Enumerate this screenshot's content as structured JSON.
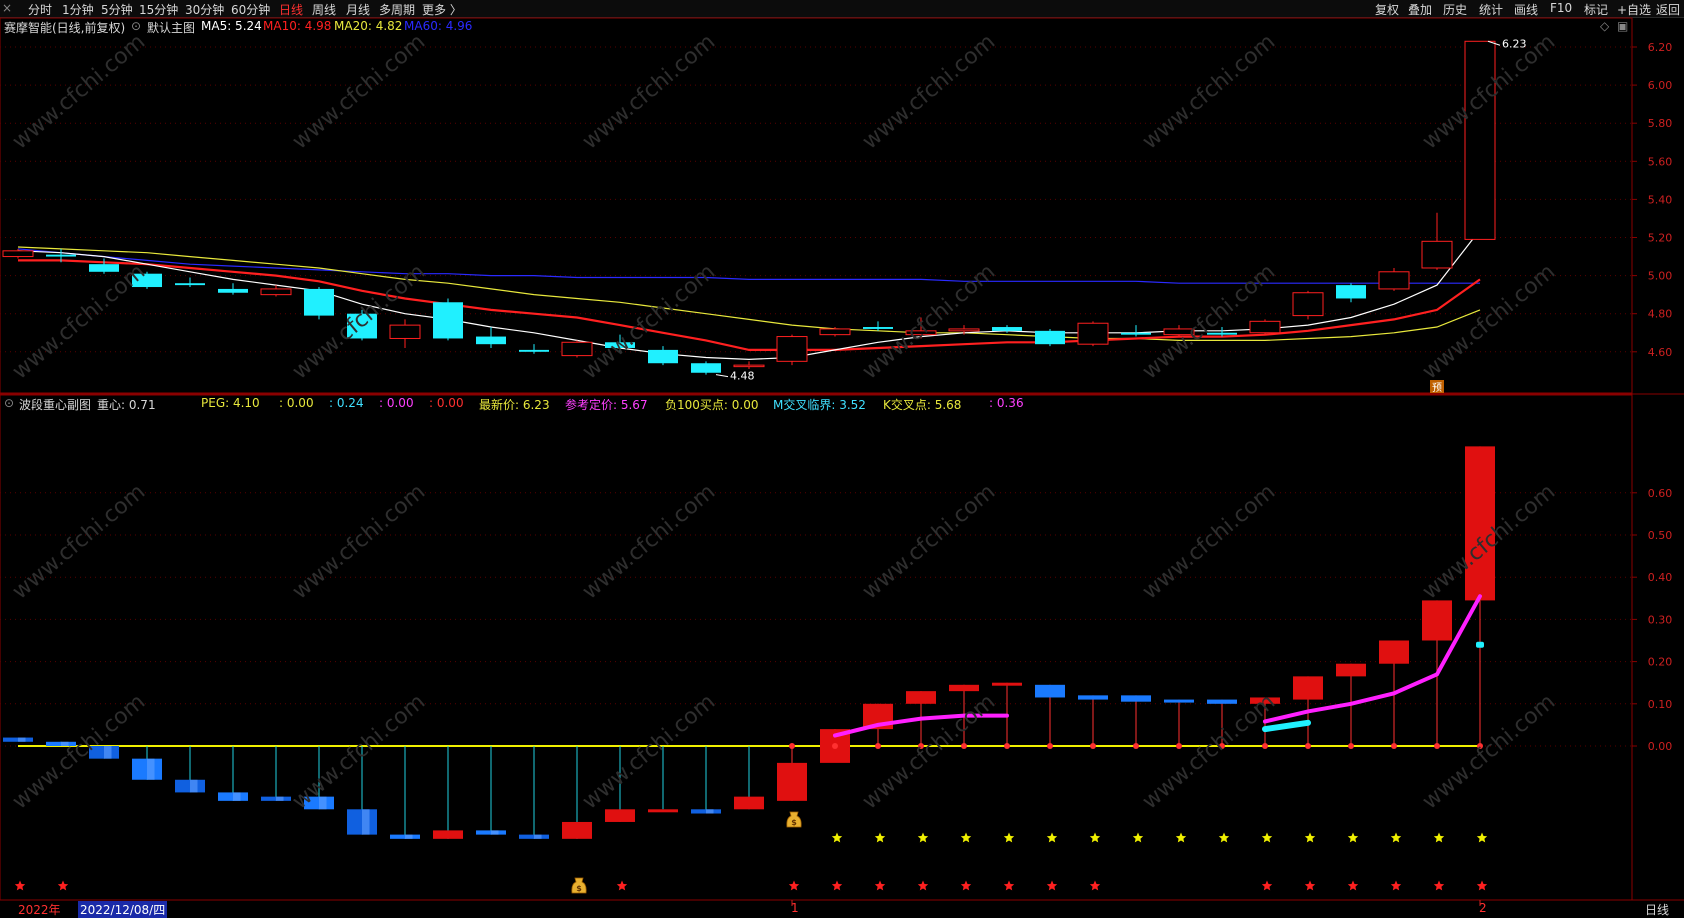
{
  "toolbar": {
    "menu_icon": "×",
    "periods": [
      {
        "label": "分时",
        "active": false
      },
      {
        "label": "1分钟",
        "active": false
      },
      {
        "label": "5分钟",
        "active": false
      },
      {
        "label": "15分钟",
        "active": false
      },
      {
        "label": "30分钟",
        "active": false
      },
      {
        "label": "60分钟",
        "active": false
      },
      {
        "label": "日线",
        "active": true
      },
      {
        "label": "周线",
        "active": false
      },
      {
        "label": "月线",
        "active": false
      },
      {
        "label": "多周期",
        "active": false
      },
      {
        "label": "更多 〉",
        "active": false
      }
    ],
    "right_items": [
      "复权",
      "叠加",
      "历史",
      "统计",
      "画线",
      "F10",
      "标记",
      "+自选",
      "返回"
    ]
  },
  "main_chart": {
    "title": "赛摩智能(日线,前复权)",
    "indicator_name": "默认主图",
    "ma": [
      {
        "label": "MA5: 5.24",
        "color": "#ffffff"
      },
      {
        "label": "MA10: 4.98",
        "color": "#ff2020"
      },
      {
        "label": "MA20: 4.82",
        "color": "#e8e83c"
      },
      {
        "label": "MA60: 4.96",
        "color": "#2a2aff"
      }
    ],
    "y_ticks": [
      "6.20",
      "6.00",
      "5.80",
      "5.60",
      "5.40",
      "5.20",
      "5.00",
      "4.80",
      "4.60"
    ],
    "high_label": "6.23",
    "low_label": "4.48",
    "pre_marker": "预",
    "candles": [
      {
        "o": 5.1,
        "c": 5.13,
        "h": 5.14,
        "l": 5.09
      },
      {
        "o": 5.11,
        "c": 5.1,
        "h": 5.14,
        "l": 5.07
      },
      {
        "o": 5.06,
        "c": 5.02,
        "h": 5.09,
        "l": 5.01
      },
      {
        "o": 5.01,
        "c": 4.94,
        "h": 5.02,
        "l": 4.93
      },
      {
        "o": 4.96,
        "c": 4.95,
        "h": 4.99,
        "l": 4.94
      },
      {
        "o": 4.93,
        "c": 4.91,
        "h": 4.96,
        "l": 4.9
      },
      {
        "o": 4.9,
        "c": 4.93,
        "h": 4.95,
        "l": 4.89
      },
      {
        "o": 4.93,
        "c": 4.79,
        "h": 4.94,
        "l": 4.77
      },
      {
        "o": 4.8,
        "c": 4.67,
        "h": 4.82,
        "l": 4.66
      },
      {
        "o": 4.67,
        "c": 4.74,
        "h": 4.77,
        "l": 4.62
      },
      {
        "o": 4.86,
        "c": 4.67,
        "h": 4.88,
        "l": 4.66
      },
      {
        "o": 4.68,
        "c": 4.64,
        "h": 4.73,
        "l": 4.62
      },
      {
        "o": 4.61,
        "c": 4.6,
        "h": 4.64,
        "l": 4.59
      },
      {
        "o": 4.58,
        "c": 4.65,
        "h": 4.66,
        "l": 4.57
      },
      {
        "o": 4.65,
        "c": 4.62,
        "h": 4.69,
        "l": 4.6
      },
      {
        "o": 4.61,
        "c": 4.54,
        "h": 4.63,
        "l": 4.53
      },
      {
        "o": 4.54,
        "c": 4.49,
        "h": 4.55,
        "l": 4.48
      },
      {
        "o": 4.53,
        "c": 4.53,
        "h": 4.55,
        "l": 4.51
      },
      {
        "o": 4.55,
        "c": 4.68,
        "h": 4.69,
        "l": 4.53
      },
      {
        "o": 4.69,
        "c": 4.72,
        "h": 4.73,
        "l": 4.68
      },
      {
        "o": 4.73,
        "c": 4.72,
        "h": 4.76,
        "l": 4.71
      },
      {
        "o": 4.69,
        "c": 4.71,
        "h": 4.78,
        "l": 4.67
      },
      {
        "o": 4.71,
        "c": 4.72,
        "h": 4.74,
        "l": 4.69
      },
      {
        "o": 4.73,
        "c": 4.71,
        "h": 4.74,
        "l": 4.7
      },
      {
        "o": 4.71,
        "c": 4.64,
        "h": 4.72,
        "l": 4.63
      },
      {
        "o": 4.64,
        "c": 4.75,
        "h": 4.76,
        "l": 4.63
      },
      {
        "o": 4.7,
        "c": 4.69,
        "h": 4.74,
        "l": 4.68
      },
      {
        "o": 4.69,
        "c": 4.72,
        "h": 4.74,
        "l": 4.68
      },
      {
        "o": 4.7,
        "c": 4.69,
        "h": 4.73,
        "l": 4.68
      },
      {
        "o": 4.7,
        "c": 4.76,
        "h": 4.77,
        "l": 4.69
      },
      {
        "o": 4.79,
        "c": 4.91,
        "h": 4.92,
        "l": 4.77
      },
      {
        "o": 4.95,
        "c": 4.88,
        "h": 4.96,
        "l": 4.86
      },
      {
        "o": 4.93,
        "c": 5.02,
        "h": 5.04,
        "l": 4.92
      },
      {
        "o": 5.04,
        "c": 5.18,
        "h": 5.33,
        "l": 5.03
      },
      {
        "o": 5.19,
        "c": 6.23,
        "h": 6.23,
        "l": 5.19
      }
    ],
    "ma5": [
      5.13,
      5.12,
      5.1,
      5.06,
      5.02,
      4.98,
      4.95,
      4.92,
      4.85,
      4.8,
      4.77,
      4.73,
      4.7,
      4.66,
      4.62,
      4.59,
      4.57,
      4.56,
      4.57,
      4.61,
      4.65,
      4.68,
      4.7,
      4.71,
      4.7,
      4.7,
      4.7,
      4.71,
      4.71,
      4.72,
      4.74,
      4.78,
      4.85,
      4.95,
      5.24
    ],
    "ma10": [
      5.08,
      5.08,
      5.07,
      5.06,
      5.04,
      5.02,
      5.0,
      4.97,
      4.92,
      4.88,
      4.85,
      4.82,
      4.8,
      4.78,
      4.74,
      4.7,
      4.66,
      4.61,
      4.61,
      4.61,
      4.62,
      4.63,
      4.64,
      4.65,
      4.65,
      4.66,
      4.67,
      4.68,
      4.68,
      4.69,
      4.71,
      4.74,
      4.77,
      4.82,
      4.98
    ],
    "ma20": [
      5.15,
      5.14,
      5.13,
      5.12,
      5.1,
      5.08,
      5.06,
      5.04,
      5.01,
      4.98,
      4.96,
      4.93,
      4.9,
      4.88,
      4.86,
      4.83,
      4.8,
      4.77,
      4.74,
      4.72,
      4.71,
      4.7,
      4.7,
      4.69,
      4.68,
      4.67,
      4.67,
      4.66,
      4.66,
      4.66,
      4.67,
      4.68,
      4.7,
      4.73,
      4.82
    ],
    "ma60": [
      5.14,
      5.12,
      5.1,
      5.08,
      5.06,
      5.05,
      5.04,
      5.03,
      5.02,
      5.01,
      5.01,
      5.0,
      5.0,
      4.99,
      4.99,
      4.99,
      4.99,
      4.98,
      4.98,
      4.98,
      4.98,
      4.98,
      4.97,
      4.97,
      4.97,
      4.97,
      4.97,
      4.96,
      4.96,
      4.96,
      4.96,
      4.96,
      4.96,
      4.96,
      4.96
    ]
  },
  "sub_chart": {
    "title": "波段重心副图",
    "center_label": "重心: 0.71",
    "values": [
      {
        "text": "PEG: 4.10",
        "color": "#e8e83c"
      },
      {
        "text": ": 0.00",
        "color": "#e8e83c"
      },
      {
        "text": ": 0.24",
        "color": "#40e0ff"
      },
      {
        "text": ": 0.00",
        "color": "#ff40ff"
      },
      {
        "text": ": 0.00",
        "color": "#ff3030"
      },
      {
        "text": "最新价: 6.23",
        "color": "#e8e83c"
      },
      {
        "text": "参考定价: 5.67",
        "color": "#ff40ff"
      },
      {
        "text": "负100买点: 0.00",
        "color": "#e8e83c"
      },
      {
        "text": "M交叉临界: 3.52",
        "color": "#40e0ff"
      },
      {
        "text": "K交叉点: 5.68",
        "color": "#e8e83c"
      },
      {
        "text": ": 0.36",
        "color": "#ff40ff"
      }
    ],
    "y_ticks": [
      "0.60",
      "0.50",
      "0.40",
      "0.30",
      "0.20",
      "0.10",
      "0.00"
    ],
    "bars": [
      {
        "o": 0.02,
        "c": 0.01,
        "h": 0.02,
        "l": 0.0,
        "hi": 0.0
      },
      {
        "o": 0.01,
        "c": 0.0,
        "h": 0.02,
        "l": -0.01,
        "hi": 0.0
      },
      {
        "o": 0.0,
        "c": -0.03,
        "h": 0.0,
        "l": -0.03,
        "hi": 0.0
      },
      {
        "o": -0.03,
        "c": -0.08,
        "h": -0.03,
        "l": -0.08,
        "hi": 0.0
      },
      {
        "o": -0.08,
        "c": -0.11,
        "h": -0.08,
        "l": -0.11,
        "hi": 0.0
      },
      {
        "o": -0.11,
        "c": -0.13,
        "h": -0.11,
        "l": -0.13,
        "hi": 0.0
      },
      {
        "o": -0.12,
        "c": -0.13,
        "h": -0.12,
        "l": -0.13,
        "hi": 0.0
      },
      {
        "o": -0.12,
        "c": -0.15,
        "h": -0.12,
        "l": -0.15,
        "hi": 0.0
      },
      {
        "o": -0.15,
        "c": -0.21,
        "h": -0.15,
        "l": -0.21,
        "hi": 0.0
      },
      {
        "o": -0.21,
        "c": -0.22,
        "h": -0.21,
        "l": -0.22,
        "hi": 0.0
      },
      {
        "o": -0.22,
        "c": -0.2,
        "h": -0.2,
        "l": -0.22,
        "hi": 0.0
      },
      {
        "o": -0.2,
        "c": -0.21,
        "h": -0.2,
        "l": -0.21,
        "hi": 0.0
      },
      {
        "o": -0.21,
        "c": -0.22,
        "h": -0.21,
        "l": -0.22,
        "hi": 0.0
      },
      {
        "o": -0.22,
        "c": -0.18,
        "h": -0.18,
        "l": -0.22,
        "hi": 0.0
      },
      {
        "o": -0.18,
        "c": -0.15,
        "h": -0.15,
        "l": -0.2,
        "hi": 0.0
      },
      {
        "o": -0.15,
        "c": -0.15,
        "h": -0.15,
        "l": -0.15,
        "hi": 0.0
      },
      {
        "o": -0.15,
        "c": -0.16,
        "h": -0.15,
        "l": -0.16,
        "hi": 0.0
      },
      {
        "o": -0.15,
        "c": -0.12,
        "h": -0.12,
        "l": -0.15,
        "hi": 0.0
      },
      {
        "o": -0.13,
        "c": -0.04,
        "h": -0.04,
        "l": -0.13,
        "hi": 0.0
      },
      {
        "o": -0.04,
        "c": 0.04,
        "h": 0.04,
        "l": -0.13,
        "hi": 0.0
      },
      {
        "o": 0.04,
        "c": 0.1,
        "h": 0.1,
        "l": -0.03,
        "hi": 0.0
      },
      {
        "o": 0.1,
        "c": 0.13,
        "h": 0.13,
        "l": 0.1,
        "hi": 0.0
      },
      {
        "o": 0.13,
        "c": 0.145,
        "h": 0.15,
        "l": 0.13,
        "hi": 0.0
      },
      {
        "o": 0.145,
        "c": 0.15,
        "h": 0.15,
        "l": 0.14,
        "hi": 0.0
      },
      {
        "o": 0.145,
        "c": 0.115,
        "h": 0.145,
        "l": 0.115,
        "hi": 0.0
      },
      {
        "o": 0.12,
        "c": 0.11,
        "h": 0.12,
        "l": 0.11,
        "hi": 0.0
      },
      {
        "o": 0.12,
        "c": 0.105,
        "h": 0.12,
        "l": 0.105,
        "hi": 0.0
      },
      {
        "o": 0.11,
        "c": 0.105,
        "h": 0.11,
        "l": 0.105,
        "hi": 0.0
      },
      {
        "o": 0.11,
        "c": 0.1,
        "h": 0.11,
        "l": 0.1,
        "hi": 0.0
      },
      {
        "o": 0.1,
        "c": 0.115,
        "h": 0.115,
        "l": 0.1,
        "hi": 0.0
      },
      {
        "o": 0.11,
        "c": 0.165,
        "h": 0.165,
        "l": 0.11,
        "hi": 0.0
      },
      {
        "o": 0.165,
        "c": 0.195,
        "h": 0.195,
        "l": 0.165,
        "hi": 0.0
      },
      {
        "o": 0.195,
        "c": 0.25,
        "h": 0.25,
        "l": 0.195,
        "hi": 0.0
      },
      {
        "o": 0.25,
        "c": 0.345,
        "h": 0.345,
        "l": 0.25,
        "hi": 0.0
      },
      {
        "o": 0.345,
        "c": 0.71,
        "h": 0.71,
        "l": 0.345,
        "hi": 0.0
      }
    ],
    "magenta_line": [
      [
        19,
        0.025
      ],
      [
        20,
        0.05
      ],
      [
        21,
        0.065
      ],
      [
        22,
        0.072
      ],
      [
        23,
        0.072
      ],
      [
        29,
        0.058
      ],
      [
        30,
        0.082
      ],
      [
        31,
        0.1
      ],
      [
        32,
        0.125
      ],
      [
        33,
        0.17
      ],
      [
        34,
        0.355
      ]
    ],
    "cyan_line": [
      [
        29,
        0.04
      ],
      [
        30,
        0.055
      ]
    ],
    "cyan_dot": [
      34,
      0.24
    ],
    "red_stars": [
      0,
      1,
      14,
      18,
      19,
      20,
      21,
      22,
      23,
      24,
      25,
      29,
      30,
      31,
      32,
      33,
      34
    ],
    "yellow_stars": [
      19,
      20,
      21,
      22,
      23,
      24,
      25,
      26,
      27,
      28,
      29,
      30,
      31,
      32,
      33,
      34
    ],
    "money_bags": [
      13,
      18
    ]
  },
  "footer": {
    "year": "2022年",
    "date": "2022/12/08/四",
    "marker1": "1",
    "marker2": "2",
    "period": "日线"
  },
  "watermark": "www.cfchi.com"
}
